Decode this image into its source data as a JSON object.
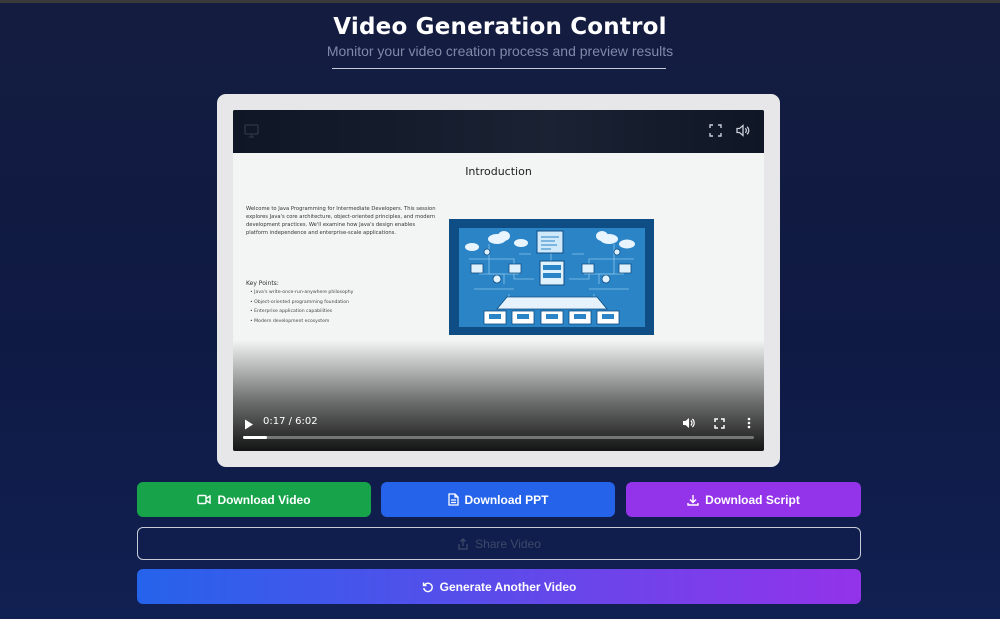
{
  "header": {
    "title": "Video Generation Control",
    "subtitle": "Monitor your video creation process and preview results"
  },
  "video": {
    "top_icons": [
      "monitor-icon",
      "fullscreen-icon",
      "volume-icon"
    ],
    "slide": {
      "title": "Introduction",
      "paragraph": "Welcome to Java Programming for Intermediate Developers. This session explores Java's core architecture, object-oriented principles, and modern development practices. We'll examine how Java's design enables platform independence and enterprise-scale applications.",
      "key_points_heading": "Key Points:",
      "key_points": [
        "Java's write-once-run-anywhere philosophy",
        "Object-oriented programming foundation",
        "Enterprise application capabilities",
        "Modern development ecosystem"
      ]
    },
    "controls": {
      "time": "0:17 / 6:02",
      "progress_fraction": 0.047,
      "icons": [
        "play-icon",
        "volume-icon",
        "fullscreen-icon",
        "more-options-icon"
      ]
    }
  },
  "actions": {
    "download_video": "Download Video",
    "download_ppt": "Download PPT",
    "download_script": "Download Script",
    "share_video": "Share Video",
    "generate_another": "Generate Another Video"
  },
  "colors": {
    "download_video": "#16a34a",
    "download_ppt": "#2563eb",
    "download_script": "#9333ea",
    "gradient_start": "#2563eb",
    "gradient_end": "#9333ea",
    "background": "#111c45"
  }
}
